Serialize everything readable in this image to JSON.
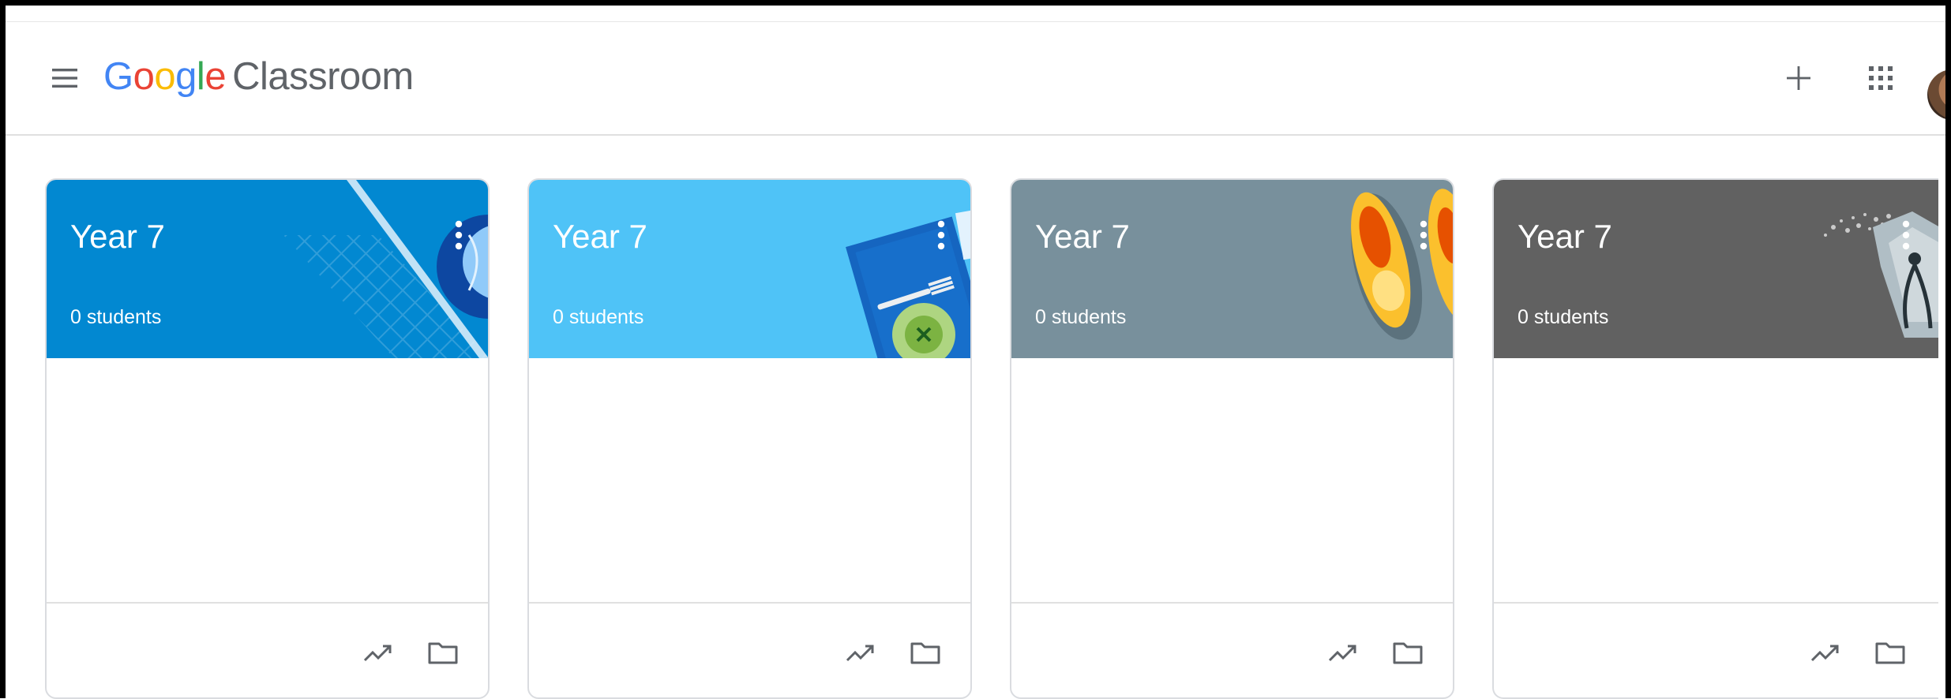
{
  "header": {
    "brand_letters": [
      {
        "char": "G",
        "color": "#4285F4"
      },
      {
        "char": "o",
        "color": "#EA4335"
      },
      {
        "char": "o",
        "color": "#FBBC05"
      },
      {
        "char": "g",
        "color": "#4285F4"
      },
      {
        "char": "l",
        "color": "#34A853"
      },
      {
        "char": "e",
        "color": "#EA4335"
      }
    ],
    "product": "Classroom",
    "menu_icon": "hamburger-menu-icon",
    "create_icon": "plus-icon",
    "apps_icon": "apps-grid-icon"
  },
  "cards": [
    {
      "title": "Year 7",
      "subtitle": "0 students",
      "color": "#0288D1",
      "art": "geometry"
    },
    {
      "title": "Year 7",
      "subtitle": "0 students",
      "color": "#4FC3F7",
      "art": "food"
    },
    {
      "title": "Year 7",
      "subtitle": "0 students",
      "color": "#78909C",
      "art": "shoes"
    },
    {
      "title": "Year 7",
      "subtitle": "0 students",
      "color": "#616161",
      "art": "tools"
    }
  ],
  "colors": {
    "text_secondary": "#5f6368",
    "divider": "#e0e0e0",
    "icon": "#5f6368"
  }
}
